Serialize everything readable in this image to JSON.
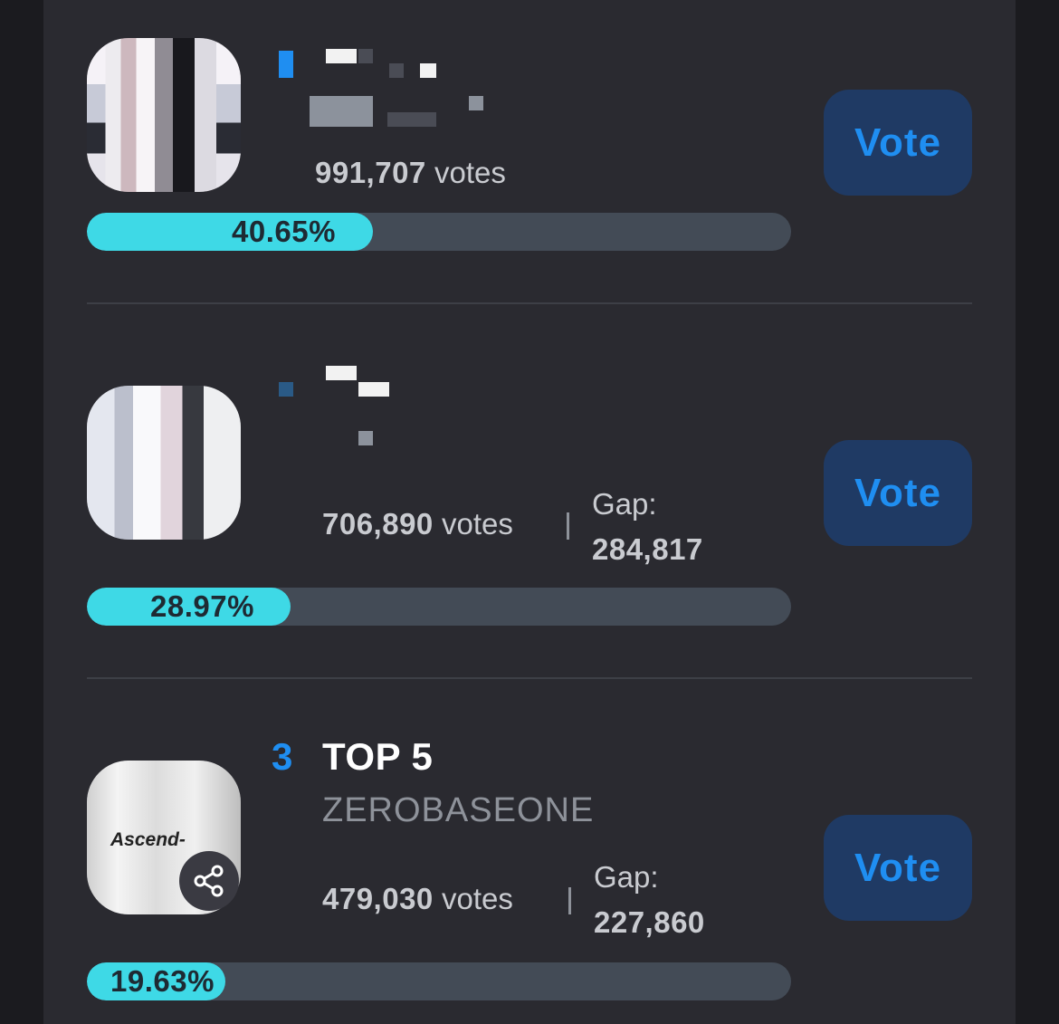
{
  "entries": [
    {
      "rank": "",
      "title": "",
      "artist": "",
      "votes_number": "991,707",
      "votes_label": "votes",
      "gap_label": "",
      "gap_value": "",
      "percent_label": "40.65%",
      "percent_value": 0.4065,
      "vote_label": "Vote"
    },
    {
      "rank": "",
      "title": "",
      "artist": "",
      "votes_number": "706,890",
      "votes_label": "votes",
      "gap_label": "Gap:",
      "gap_value": "284,817",
      "percent_label": "28.97%",
      "percent_value": 0.2897,
      "vote_label": "Vote"
    },
    {
      "rank": "3",
      "title": "TOP 5",
      "artist": "ZEROBASEONE",
      "album_text": "Ascend-",
      "votes_number": "479,030",
      "votes_label": "votes",
      "gap_label": "Gap:",
      "gap_value": "227,860",
      "percent_label": "19.63%",
      "percent_value": 0.1963,
      "vote_label": "Vote"
    }
  ],
  "colors": {
    "accent": "#1f8ef1",
    "bar_fill": "#3ed9e6",
    "bar_track": "#434b56",
    "button_bg": "#1f3a64",
    "panel_bg": "#2a2a30"
  },
  "icons": [
    "share-icon"
  ]
}
